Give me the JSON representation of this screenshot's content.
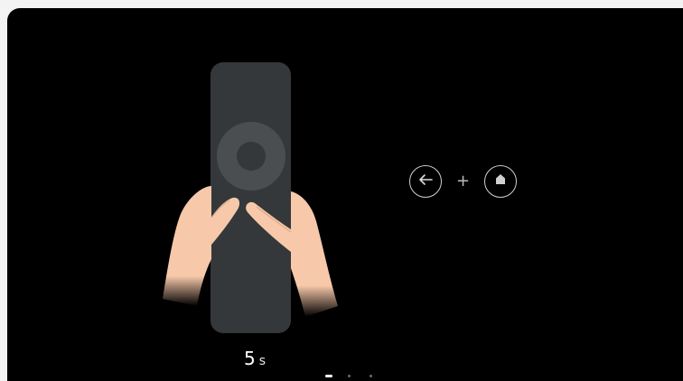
{
  "screen": {
    "background_color": "#000000"
  },
  "illustration": {
    "description_icon": "remote-in-hands-icon",
    "remote_color": "#35383a",
    "skin_color": "#f6c6a8"
  },
  "combo": {
    "back_icon": "back-arrow-icon",
    "plus_label": "+",
    "home_icon": "home-icon"
  },
  "timer": {
    "value": "5",
    "unit": "s"
  },
  "pager": {
    "total": 3,
    "active_index": 0
  }
}
